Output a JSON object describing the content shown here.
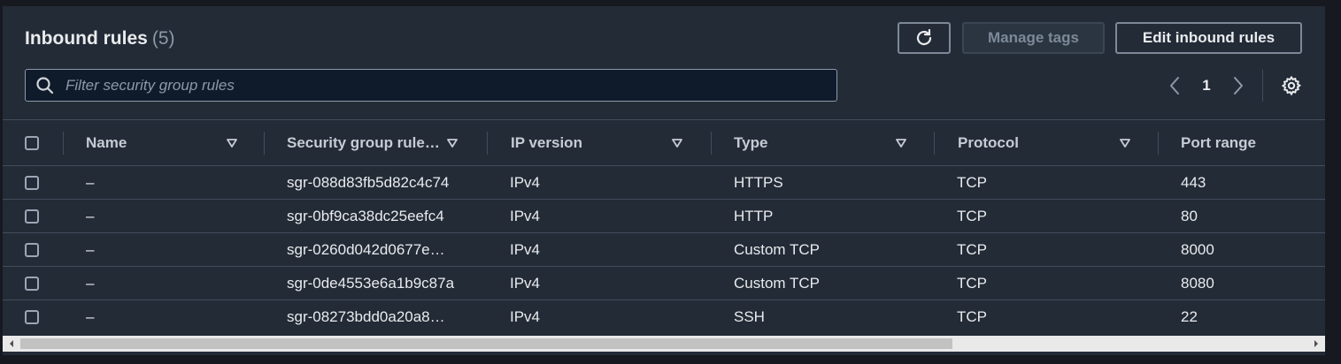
{
  "header": {
    "title": "Inbound rules",
    "count": "(5)",
    "manage_tags_label": "Manage tags",
    "edit_label": "Edit inbound rules"
  },
  "search": {
    "placeholder": "Filter security group rules"
  },
  "pagination": {
    "current_page": "1"
  },
  "icons": {
    "refresh": "refresh-icon",
    "search": "search-icon",
    "prev": "chevron-left-icon",
    "next": "chevron-right-icon",
    "settings": "gear-icon",
    "sort": "sort-down-icon"
  },
  "columns": [
    "Name",
    "Security group rule…",
    "IP version",
    "Type",
    "Protocol",
    "Port range"
  ],
  "rows": [
    {
      "name": "–",
      "rule_id": "sgr-088d83fb5d82c4c74",
      "ip_version": "IPv4",
      "type": "HTTPS",
      "protocol": "TCP",
      "port_range": "443"
    },
    {
      "name": "–",
      "rule_id": "sgr-0bf9ca38dc25eefc4",
      "ip_version": "IPv4",
      "type": "HTTP",
      "protocol": "TCP",
      "port_range": "80"
    },
    {
      "name": "–",
      "rule_id": "sgr-0260d042d0677e…",
      "ip_version": "IPv4",
      "type": "Custom TCP",
      "protocol": "TCP",
      "port_range": "8000"
    },
    {
      "name": "–",
      "rule_id": "sgr-0de4553e6a1b9c87a",
      "ip_version": "IPv4",
      "type": "Custom TCP",
      "protocol": "TCP",
      "port_range": "8080"
    },
    {
      "name": "–",
      "rule_id": "sgr-08273bdd0a20a8…",
      "ip_version": "IPv4",
      "type": "SSH",
      "protocol": "TCP",
      "port_range": "22"
    }
  ],
  "colors": {
    "panel_bg": "#232b37",
    "text_primary": "#e9ebed",
    "text_muted": "#8d99a8",
    "border": "#414d5c"
  }
}
